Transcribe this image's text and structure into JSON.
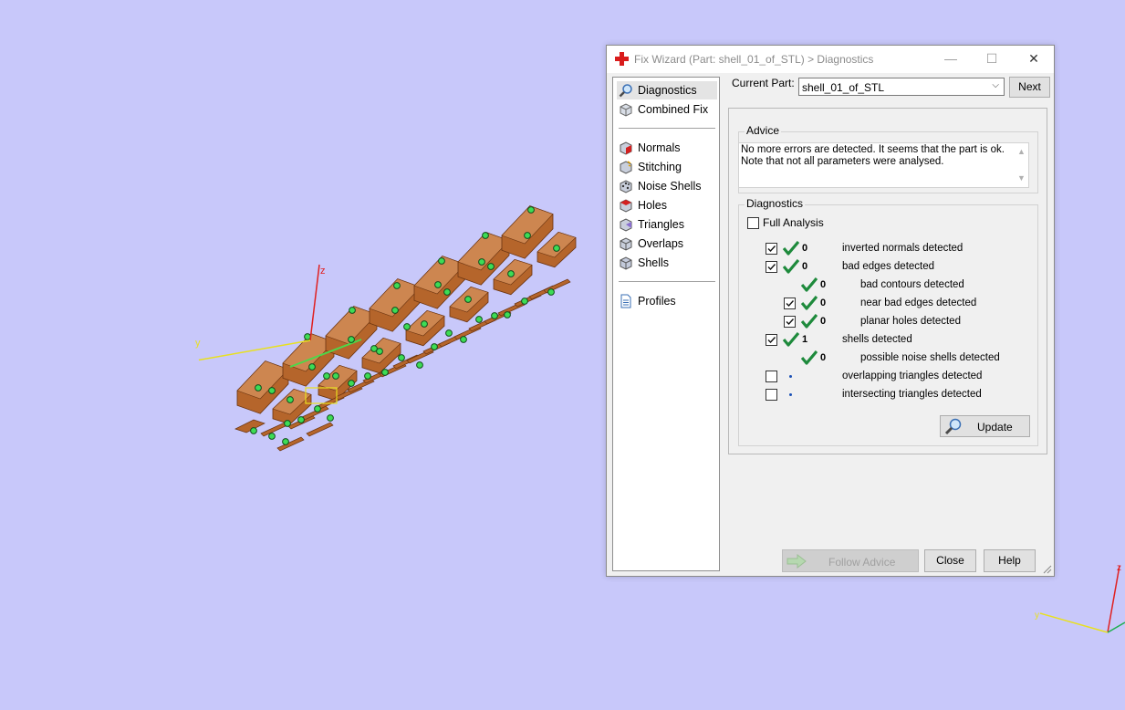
{
  "window": {
    "title": "Fix Wizard (Part: shell_01_of_STL) > Diagnostics",
    "controls": {
      "minimize": "—",
      "maximize": "☐",
      "close": "✕"
    }
  },
  "nav": {
    "items": [
      {
        "label": "Diagnostics",
        "icon": "magnifier-icon",
        "selected": true
      },
      {
        "label": "Combined Fix",
        "icon": "combined-fix-cube-icon"
      },
      {
        "label": "Normals",
        "icon": "normals-cube-icon"
      },
      {
        "label": "Stitching",
        "icon": "stitching-cube-icon"
      },
      {
        "label": "Noise Shells",
        "icon": "noise-shells-cube-icon"
      },
      {
        "label": "Holes",
        "icon": "holes-cube-icon"
      },
      {
        "label": "Triangles",
        "icon": "triangles-cube-icon"
      },
      {
        "label": "Overlaps",
        "icon": "overlaps-cube-icon"
      },
      {
        "label": "Shells",
        "icon": "shells-cube-icon"
      },
      {
        "label": "Profiles",
        "icon": "document-icon"
      }
    ]
  },
  "current_part": {
    "label": "Current Part:",
    "value": "shell_01_of_STL",
    "next_label": "Next"
  },
  "advice": {
    "title": "Advice",
    "text": "No more errors are detected. It seems that the part is ok.\nNote that not all parameters were analysed."
  },
  "diagnostics": {
    "title": "Diagnostics",
    "full_analysis_label": "Full Analysis",
    "full_analysis_checked": false,
    "rows": [
      {
        "checkbox": true,
        "checked": true,
        "status": "ok",
        "count": "0",
        "label": "inverted normals detected",
        "indent": 0
      },
      {
        "checkbox": true,
        "checked": true,
        "status": "ok",
        "count": "0",
        "label": "bad edges detected",
        "indent": 0
      },
      {
        "checkbox": false,
        "checked": false,
        "status": "ok",
        "count": "0",
        "label": "bad contours detected",
        "indent": 1
      },
      {
        "checkbox": true,
        "checked": true,
        "status": "ok",
        "count": "0",
        "label": "near bad edges detected",
        "indent": 1
      },
      {
        "checkbox": true,
        "checked": true,
        "status": "ok",
        "count": "0",
        "label": "planar holes detected",
        "indent": 1
      },
      {
        "checkbox": true,
        "checked": true,
        "status": "ok",
        "count": "1",
        "label": "shells detected",
        "indent": 0
      },
      {
        "checkbox": false,
        "checked": false,
        "status": "ok",
        "count": "0",
        "label": "possible noise shells detected",
        "indent": 1
      },
      {
        "checkbox": true,
        "checked": false,
        "status": "none",
        "count": "",
        "label": "overlapping triangles detected",
        "indent": 0
      },
      {
        "checkbox": true,
        "checked": false,
        "status": "none",
        "count": "",
        "label": "intersecting triangles detected",
        "indent": 0
      }
    ],
    "update_label": "Update"
  },
  "footer": {
    "follow_advice_label": "Follow Advice",
    "close_label": "Close",
    "help_label": "Help"
  },
  "viewport": {
    "axes_main": [
      "z",
      "y"
    ],
    "axes_corner": [
      "z",
      "y"
    ],
    "colors": {
      "background": "#c8c8fa",
      "part": "#b5652b",
      "marker": "#3ddc55",
      "axis_z": "#e02020",
      "axis_y": "#e8e020"
    }
  }
}
